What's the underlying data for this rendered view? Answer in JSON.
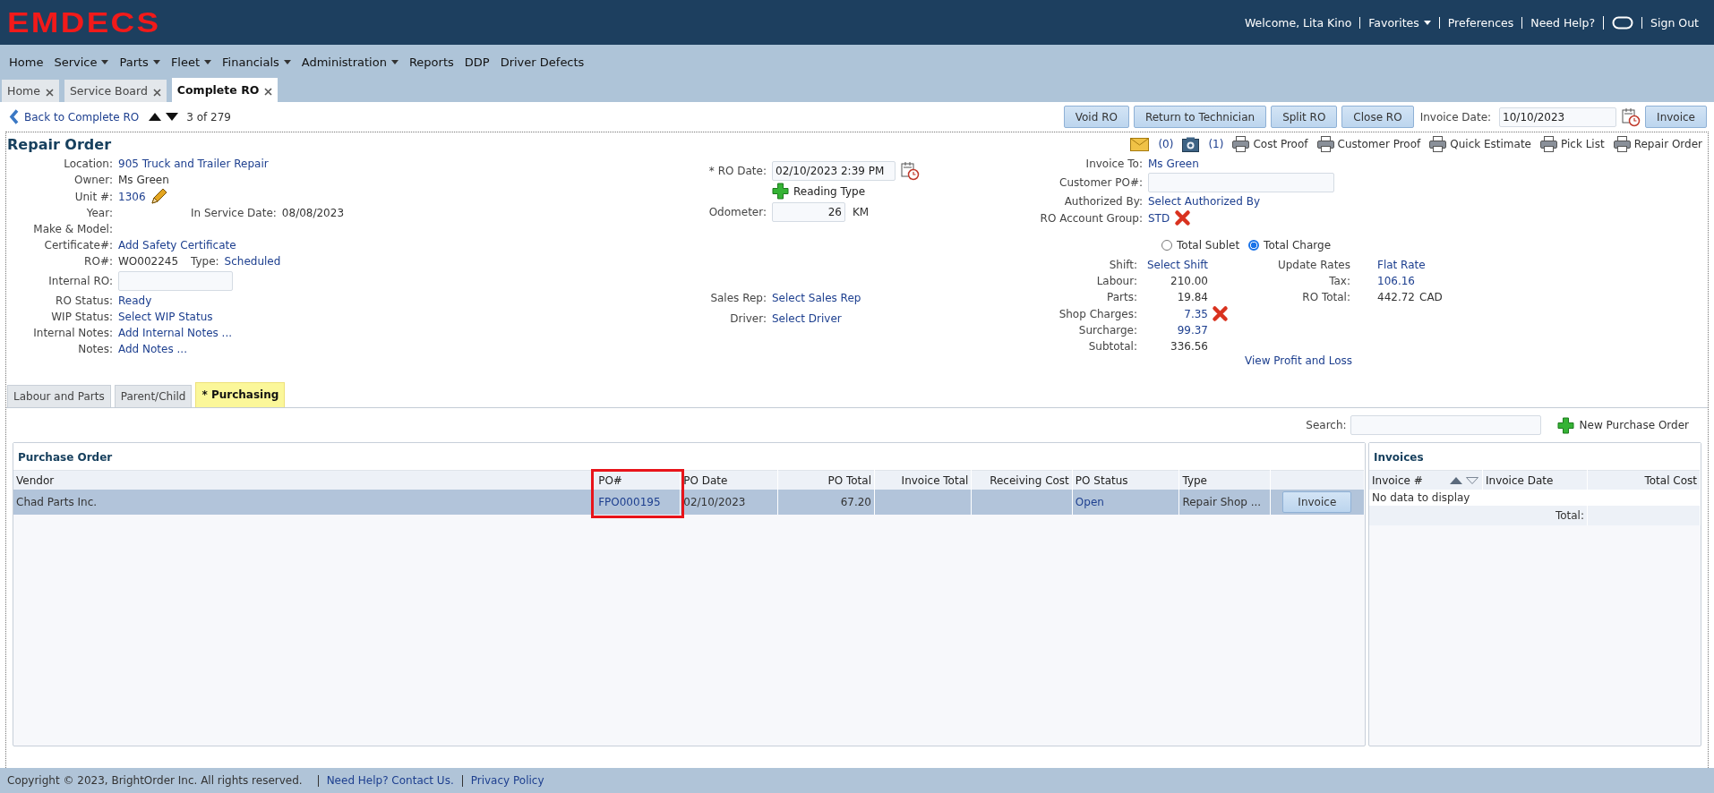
{
  "header": {
    "logo": "EMDECS",
    "user_links": [
      {
        "kind": "text",
        "label": "Welcome, Lita Kino"
      },
      {
        "kind": "dropdown",
        "label": "Favorites"
      },
      {
        "kind": "link",
        "label": "Preferences"
      },
      {
        "kind": "link",
        "label": "Need Help?"
      },
      {
        "kind": "chat"
      },
      {
        "kind": "link",
        "label": "Sign Out"
      }
    ]
  },
  "menu": [
    {
      "label": "Home",
      "dropdown": false
    },
    {
      "label": "Service",
      "dropdown": true
    },
    {
      "label": "Parts",
      "dropdown": true
    },
    {
      "label": "Fleet",
      "dropdown": true
    },
    {
      "label": "Financials",
      "dropdown": true
    },
    {
      "label": "Administration",
      "dropdown": true
    },
    {
      "label": "Reports",
      "dropdown": false
    },
    {
      "label": "DDP",
      "dropdown": false
    },
    {
      "label": "Driver Defects",
      "dropdown": false
    }
  ],
  "tabs": [
    {
      "label": "Home",
      "selected": false
    },
    {
      "label": "Service Board",
      "selected": false
    },
    {
      "label": "Complete RO",
      "selected": true
    }
  ],
  "navigation": {
    "back": "Back to Complete RO",
    "counter": "3 of 279"
  },
  "actions": [
    "Void RO",
    "Return to Technician",
    "Split RO",
    "Close RO"
  ],
  "invoice_date": {
    "label": "Invoice Date:",
    "value": "10/10/2023"
  },
  "invoice_button": "Invoice",
  "repair_order": {
    "title": "Repair Order",
    "print_links": [
      {
        "kind": "mail",
        "label": "(0)"
      },
      {
        "kind": "camera",
        "label": "(1)"
      },
      {
        "kind": "print",
        "label": "Cost Proof"
      },
      {
        "kind": "print",
        "label": "Customer Proof"
      },
      {
        "kind": "print",
        "label": "Quick Estimate"
      },
      {
        "kind": "print",
        "label": "Pick List"
      },
      {
        "kind": "print",
        "label": "Repair Order"
      }
    ],
    "left_fields": [
      {
        "label": "Location:",
        "kind": "link",
        "value": "905 Truck and Trailer Repair"
      },
      {
        "label": "Owner:",
        "kind": "text",
        "value": "Ms Green"
      },
      {
        "label": "Unit #:",
        "kind": "link",
        "value": "1306",
        "editable": true
      },
      {
        "label": "Year:",
        "kind": "text",
        "extra": {
          "label": "In Service Date:",
          "value": "08/08/2023",
          "kind": "text"
        }
      },
      {
        "label": "Make & Model:",
        "kind": "text"
      },
      {
        "label": "Certificate#:",
        "kind": "link",
        "value": "Add Safety Certificate"
      },
      {
        "label": "RO#:",
        "kind": "text",
        "value": "WO002245",
        "extra": {
          "label": "Type:",
          "value": "Scheduled",
          "kind": "link"
        }
      },
      {
        "label": "Internal RO:",
        "kind": "input"
      },
      {
        "label": "RO Status:",
        "kind": "link",
        "value": "Ready"
      },
      {
        "label": "WIP Status:",
        "kind": "link",
        "value": "Select WIP Status"
      },
      {
        "label": "Internal Notes:",
        "kind": "link",
        "value": "Add Internal Notes ..."
      },
      {
        "label": "Notes:",
        "kind": "link",
        "value": "Add Notes ..."
      }
    ],
    "middle_top": [
      {
        "label": "* RO Date:",
        "kind": "date",
        "value": "02/10/2023 2:39 PM"
      },
      {
        "kind": "add",
        "value": "Reading Type"
      },
      {
        "label": "Odometer:",
        "kind": "number",
        "value": "26",
        "unit": "KM"
      }
    ],
    "middle_bottom": [
      {
        "label": "Sales Rep:",
        "kind": "link",
        "value": "Select Sales Rep"
      },
      {
        "label": "Driver:",
        "kind": "link",
        "value": "Select Driver"
      }
    ],
    "right_fields": [
      {
        "label": "Invoice To:",
        "kind": "link",
        "value": "Ms Green"
      },
      {
        "label": "Customer PO#:",
        "kind": "input"
      },
      {
        "label": "Authorized By:",
        "kind": "link",
        "value": "Select Authorized By"
      },
      {
        "label": "RO Account Group:",
        "kind": "link",
        "value": "STD",
        "removable": true
      }
    ],
    "total_mode": [
      {
        "label": "Total Sublet",
        "selected": false
      },
      {
        "label": "Total Charge",
        "selected": true
      }
    ],
    "charges": [
      {
        "label": "Shift:",
        "kind": "link",
        "value": "Select Shift"
      },
      {
        "label": "Labour:",
        "kind": "text",
        "value": "210.00"
      },
      {
        "label": "Parts:",
        "kind": "text",
        "value": "19.84"
      },
      {
        "label": "Shop Charges:",
        "kind": "link",
        "value": "7.35",
        "removable": true
      },
      {
        "label": "Surcharge:",
        "kind": "link",
        "value": "99.37"
      },
      {
        "label": "Subtotal:",
        "kind": "text",
        "value": "336.56"
      }
    ],
    "rate_links": [
      "Update Rates",
      "Flat Rate"
    ],
    "summary": [
      {
        "label": "Tax:",
        "kind": "link",
        "value": "106.16"
      },
      {
        "label": "RO Total:",
        "kind": "text",
        "value": "442.72",
        "unit": "CAD"
      }
    ],
    "profit_link": "View Profit and Loss"
  },
  "sub_tabs": [
    {
      "label": "Labour and Parts",
      "selected": false
    },
    {
      "label": "Parent/Child",
      "selected": false
    },
    {
      "label": "* Purchasing",
      "selected": true
    }
  ],
  "search": {
    "label": "Search:"
  },
  "new_purchase_order": "New Purchase Order",
  "purchase_order": {
    "title": "Purchase Order",
    "columns": [
      {
        "label": "Vendor",
        "highlighted": false
      },
      {
        "label": "PO#",
        "highlighted": true
      },
      {
        "label": "PO Date",
        "highlighted": false
      },
      {
        "label": "PO Total",
        "highlighted": false
      },
      {
        "label": "Invoice Total",
        "highlighted": false
      },
      {
        "label": "Receiving Cost",
        "highlighted": false
      },
      {
        "label": "PO Status",
        "highlighted": false
      },
      {
        "label": "Type",
        "highlighted": false
      },
      {
        "highlighted": false
      }
    ],
    "rows": [
      {
        "selected": true,
        "cells": [
          {
            "kind": "text",
            "value": "Chad Parts Inc."
          },
          {
            "kind": "link",
            "value": "FPO000195"
          },
          {
            "kind": "text",
            "value": "02/10/2023"
          },
          {
            "kind": "text",
            "value": "67.20"
          },
          {
            "kind": "empty"
          },
          {
            "kind": "empty"
          },
          {
            "kind": "link",
            "value": "Open"
          },
          {
            "kind": "text",
            "value": "Repair Shop ..."
          },
          {
            "kind": "button",
            "value": "Invoice"
          }
        ]
      }
    ]
  },
  "invoices": {
    "title": "Invoices",
    "columns": [
      {
        "label": "Invoice #",
        "sortable": true
      },
      {
        "label": "Invoice Date",
        "sortable": false
      },
      {
        "label": "Total Cost",
        "sortable": false
      }
    ],
    "empty_text": "No data to display",
    "total_label": "Total:"
  },
  "footer": [
    {
      "kind": "text",
      "label": "Copyright © 2023, BrightOrder Inc. All rights reserved."
    },
    {
      "kind": "link",
      "label": "Need Help? Contact Us."
    },
    {
      "kind": "link",
      "label": "Privacy Policy"
    }
  ]
}
